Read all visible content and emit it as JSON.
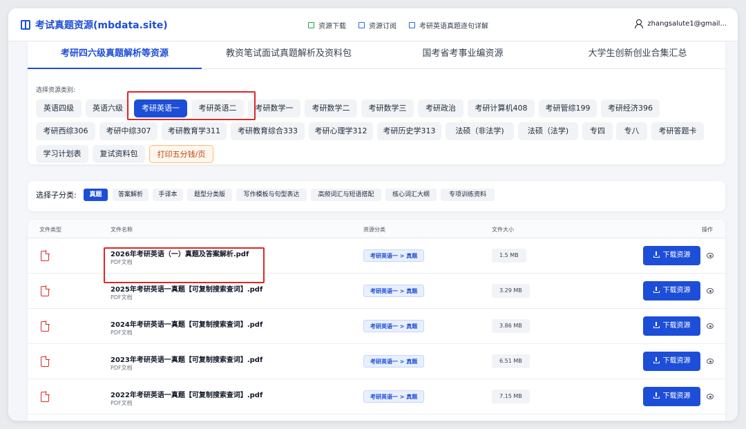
{
  "header": {
    "title": "考试真题资源(mbdata.site)",
    "nav": [
      {
        "label": "资源下载",
        "icon": "file-icon"
      },
      {
        "label": "资源订阅",
        "icon": "book-icon"
      },
      {
        "label": "考研英语真题逐句详解",
        "icon": "book-icon"
      }
    ],
    "user": "zhangsalute1@gmail..."
  },
  "tabs": [
    "考研四六级真题解析等资源",
    "教资笔试面试真题解析及资料包",
    "国考省考事业编资源",
    "大学生创新创业合集汇总"
  ],
  "active_tab": "考研四六级真题解析等资源",
  "category": {
    "label": "选择资源类别:",
    "items": [
      "英语四级",
      "英语六级",
      "考研英语一",
      "考研英语二",
      "考研数学一",
      "考研数学二",
      "考研数学三",
      "考研政治",
      "考研计算机408",
      "考研管综199",
      "考研经济396",
      "考研西综306",
      "考研中综307",
      "考研教育学311",
      "考研教育综合333",
      "考研心理学312",
      "考研历史学313",
      "法硕（非法学)",
      "法硕（法学)",
      "专四",
      "专八",
      "考研答题卡",
      "学习计划表",
      "复试资料包",
      "打印五分钱/页"
    ],
    "selected": "考研英语一"
  },
  "subcategory": {
    "label": "选择子分类:",
    "items": [
      "真题",
      "答案解析",
      "手译本",
      "题型分类版",
      "写作模板与句型表达",
      "高频词汇与短语搭配",
      "核心词汇大纲",
      "专项训练资料"
    ],
    "selected": "真题"
  },
  "table": {
    "columns": [
      "文件类型",
      "文件名称",
      "资源分类",
      "文件大小",
      "操作"
    ],
    "download_label": "下载资源",
    "rows": [
      {
        "name": "2026年考研英语（一）真题及答案解析.pdf",
        "type": "PDF文档",
        "category": "考研英语一 > 真题",
        "size": "1.5 MB"
      },
      {
        "name": "2025年考研英语一真题【可复制搜索查词】.pdf",
        "type": "PDF文档",
        "category": "考研英语一 > 真题",
        "size": "3.29 MB"
      },
      {
        "name": "2024年考研英语一真题【可复制搜索查词】.pdf",
        "type": "PDF文档",
        "category": "考研英语一 > 真题",
        "size": "3.86 MB"
      },
      {
        "name": "2023年考研英语一真题【可复制搜索查词】.pdf",
        "type": "PDF文档",
        "category": "考研英语一 > 真题",
        "size": "6.51 MB"
      },
      {
        "name": "2022年考研英语一真题【可复制搜索查词】.pdf",
        "type": "PDF文档",
        "category": "考研英语一 > 真题",
        "size": "7.15 MB"
      }
    ]
  },
  "colors": {
    "accent": "#1d4ed8",
    "highlight_box": "#dc2626",
    "pdf_icon": "#dc2626"
  }
}
